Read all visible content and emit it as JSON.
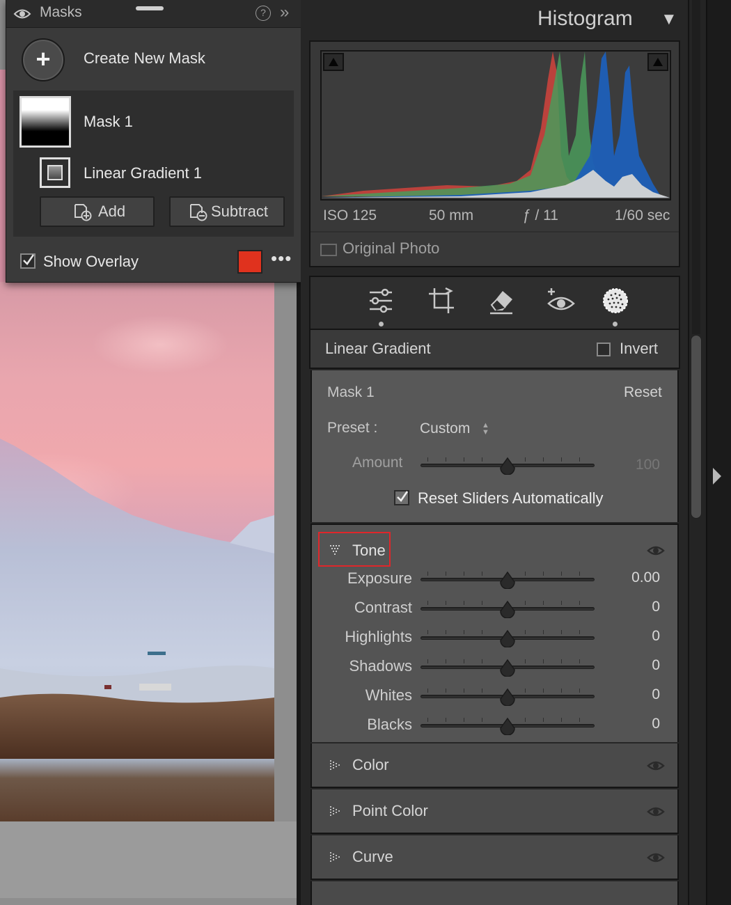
{
  "masks_panel": {
    "title": "Masks",
    "help_icon": "?",
    "create_label": "Create New Mask",
    "mask_name": "Mask 1",
    "component_name": "Linear Gradient 1",
    "add_label": "Add",
    "subtract_label": "Subtract",
    "show_overlay_label": "Show Overlay",
    "show_overlay_checked": true,
    "overlay_color": "#e0321e",
    "more_label": "•••"
  },
  "histogram": {
    "title": "Histogram",
    "toggle": "▼",
    "iso": "ISO 125",
    "focal": "50 mm",
    "aperture": "ƒ / 11",
    "shutter": "1/60 sec",
    "original_photo_label": "Original Photo"
  },
  "tools": [
    "edit-sliders-icon",
    "crop-icon",
    "eraser-icon",
    "red-eye-icon",
    "masking-icon"
  ],
  "mask_tool": {
    "title": "Linear Gradient",
    "invert_label": "Invert",
    "mask_label": "Mask 1",
    "reset_label": "Reset",
    "preset_label": "Preset :",
    "preset_value": "Custom",
    "preset_arrows": "▲▼",
    "amount_label": "Amount",
    "amount_value": "100",
    "reset_sliders_label": "Reset Sliders Automatically"
  },
  "tone": {
    "title": "Tone",
    "sliders": [
      {
        "label": "Exposure",
        "value": "0.00"
      },
      {
        "label": "Contrast",
        "value": "0"
      },
      {
        "label": "Highlights",
        "value": "0"
      },
      {
        "label": "Shadows",
        "value": "0"
      },
      {
        "label": "Whites",
        "value": "0"
      },
      {
        "label": "Blacks",
        "value": "0"
      }
    ]
  },
  "sections": [
    {
      "label": "Color"
    },
    {
      "label": "Point Color"
    },
    {
      "label": "Curve"
    }
  ],
  "colors": {
    "tone_highlight": "#e0262a",
    "panel_bg": "#262626"
  }
}
